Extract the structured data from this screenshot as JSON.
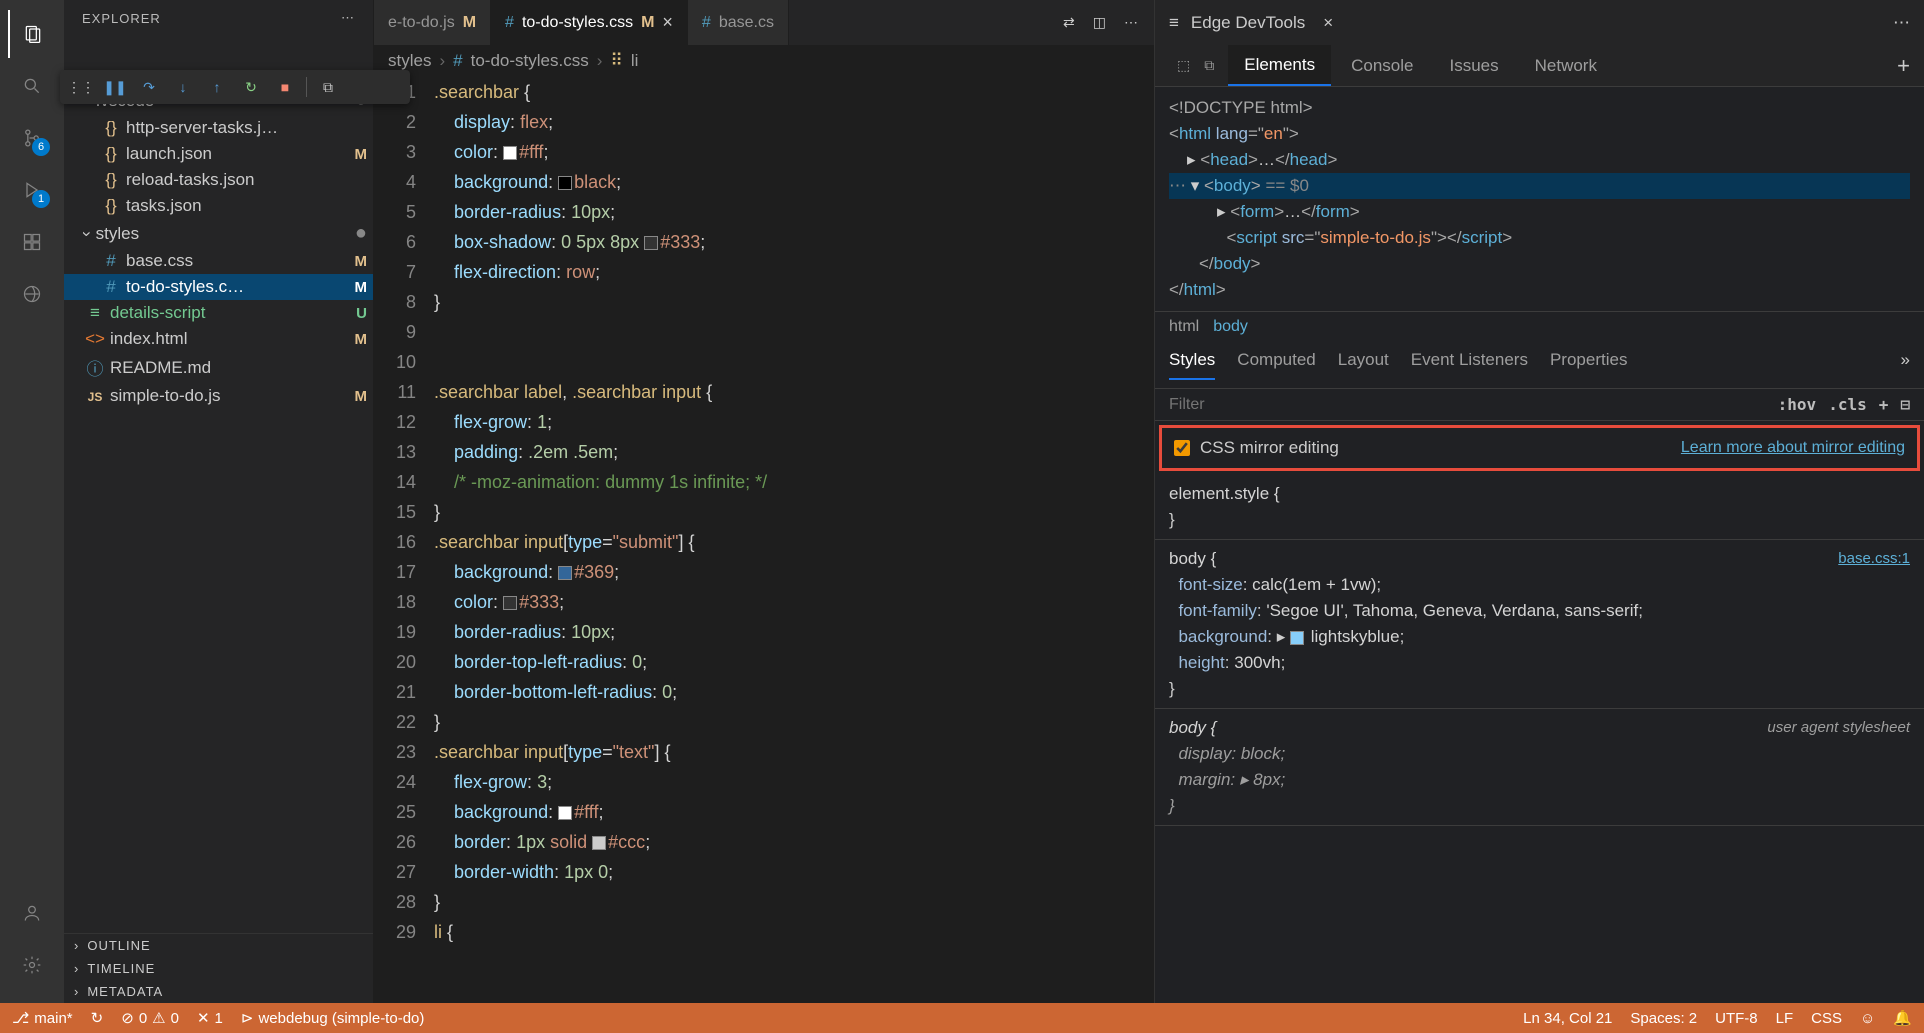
{
  "sidebar": {
    "title": "EXPLORER",
    "folders": {
      "vscode": ".vscode",
      "styles": "styles"
    },
    "files": {
      "http_server": "http-server-tasks.j…",
      "launch": "launch.json",
      "reload": "reload-tasks.json",
      "tasks": "tasks.json",
      "basecss": "base.css",
      "todostyles": "to-do-styles.c…",
      "details": "details-script",
      "index": "index.html",
      "readme": "README.md",
      "simplejs": "simple-to-do.js"
    },
    "status": {
      "M": "M",
      "U": "U"
    },
    "sections": {
      "outline": "OUTLINE",
      "timeline": "TIMELINE",
      "metadata": "METADATA"
    }
  },
  "activity": {
    "scm_badge": "6",
    "debug_badge": "1"
  },
  "tabs": {
    "t1": "e-to-do.js",
    "t2": "to-do-styles.css",
    "t3": "base.cs",
    "m": "M"
  },
  "breadcrumb": {
    "p1": "styles",
    "p2": "to-do-styles.css",
    "p3": "li"
  },
  "code": {
    "l1": ".searchbar {",
    "l2": "    display: flex;",
    "l3": "    color: #fff;",
    "l4": "    background: black;",
    "l5": "    border-radius: 10px;",
    "l6": "    box-shadow: 0 5px 8px #333;",
    "l7": "    flex-direction: row;",
    "l8": "}",
    "l9": "",
    "l10": "",
    "l11": ".searchbar label, .searchbar input {",
    "l12": "    flex-grow: 1;",
    "l13": "    padding: .2em .5em;",
    "l14": "    /* -moz-animation: dummy 1s infinite; */",
    "l15": "}",
    "l16": ".searchbar input[type=\"submit\"] {",
    "l17": "    background: #369;",
    "l18": "    color: #333;",
    "l19": "    border-radius: 10px;",
    "l20": "    border-top-left-radius: 0;",
    "l21": "    border-bottom-left-radius: 0;",
    "l22": "}",
    "l23": ".searchbar input[type=\"text\"] {",
    "l24": "    flex-grow: 3;",
    "l25": "    background: #fff;",
    "l26": "    border: 1px solid #ccc;",
    "l27": "    border-width: 1px 0;",
    "l28": "}",
    "l29": "li {"
  },
  "devtools": {
    "title": "Edge DevTools",
    "tabs": {
      "elements": "Elements",
      "console": "Console",
      "issues": "Issues",
      "network": "Network"
    },
    "dom": {
      "doctype": "<!DOCTYPE html>",
      "html_open": "html",
      "lang": "en",
      "head": "head",
      "body": "body",
      "body_hint": "== $0",
      "form": "form",
      "script": "script",
      "script_src": "simple-to-do.js"
    },
    "crumbs": {
      "html": "html",
      "body": "body"
    },
    "styles_tabs": {
      "styles": "Styles",
      "computed": "Computed",
      "layout": "Layout",
      "events": "Event Listeners",
      "props": "Properties"
    },
    "filter_placeholder": "Filter",
    "hov": ":hov",
    "cls": ".cls",
    "mirror": {
      "label": "CSS mirror editing",
      "link": "Learn more about mirror editing"
    },
    "rules": {
      "elementstyle": "element.style {",
      "body_sel": "body {",
      "body_src": "base.css:1",
      "fs": "font-size",
      "fs_v": "calc(1em + 1vw)",
      "ff": "font-family",
      "ff_v": "'Segoe UI', Tahoma, Geneva, Verdana, sans-serif",
      "bg": "background",
      "bg_v": "lightskyblue",
      "h": "height",
      "h_v": "300vh",
      "ua": "user agent stylesheet",
      "disp": "display",
      "disp_v": "block",
      "marg": "margin",
      "marg_v": "8px"
    }
  },
  "statusbar": {
    "branch": "main*",
    "sync": "↻",
    "errors": "0",
    "warnings": "0",
    "ports": "1",
    "launch": "webdebug (simple-to-do)",
    "ln": "Ln 34, Col 21",
    "spaces": "Spaces: 2",
    "encoding": "UTF-8",
    "eol": "LF",
    "lang": "CSS"
  }
}
